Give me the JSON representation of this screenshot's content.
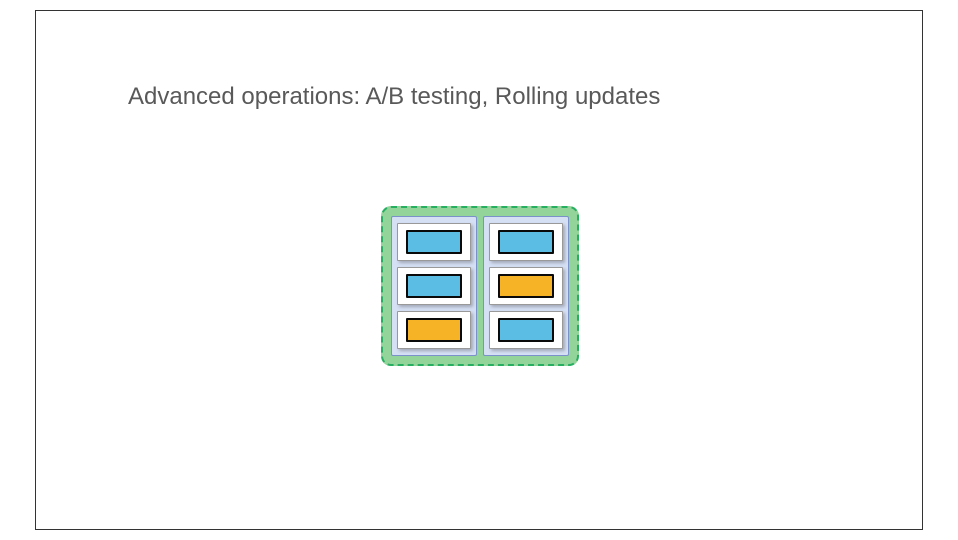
{
  "title": "Advanced operations: A/B testing, Rolling updates",
  "diagram": {
    "columns": [
      {
        "pods": [
          {
            "color": "blue"
          },
          {
            "color": "blue"
          },
          {
            "color": "orange"
          }
        ]
      },
      {
        "pods": [
          {
            "color": "blue"
          },
          {
            "color": "orange"
          },
          {
            "color": "blue"
          }
        ]
      }
    ],
    "colors": {
      "blue": "#5bbce4",
      "orange": "#f5b325",
      "container": "#93d49b",
      "column": "#d6e0f5"
    }
  }
}
